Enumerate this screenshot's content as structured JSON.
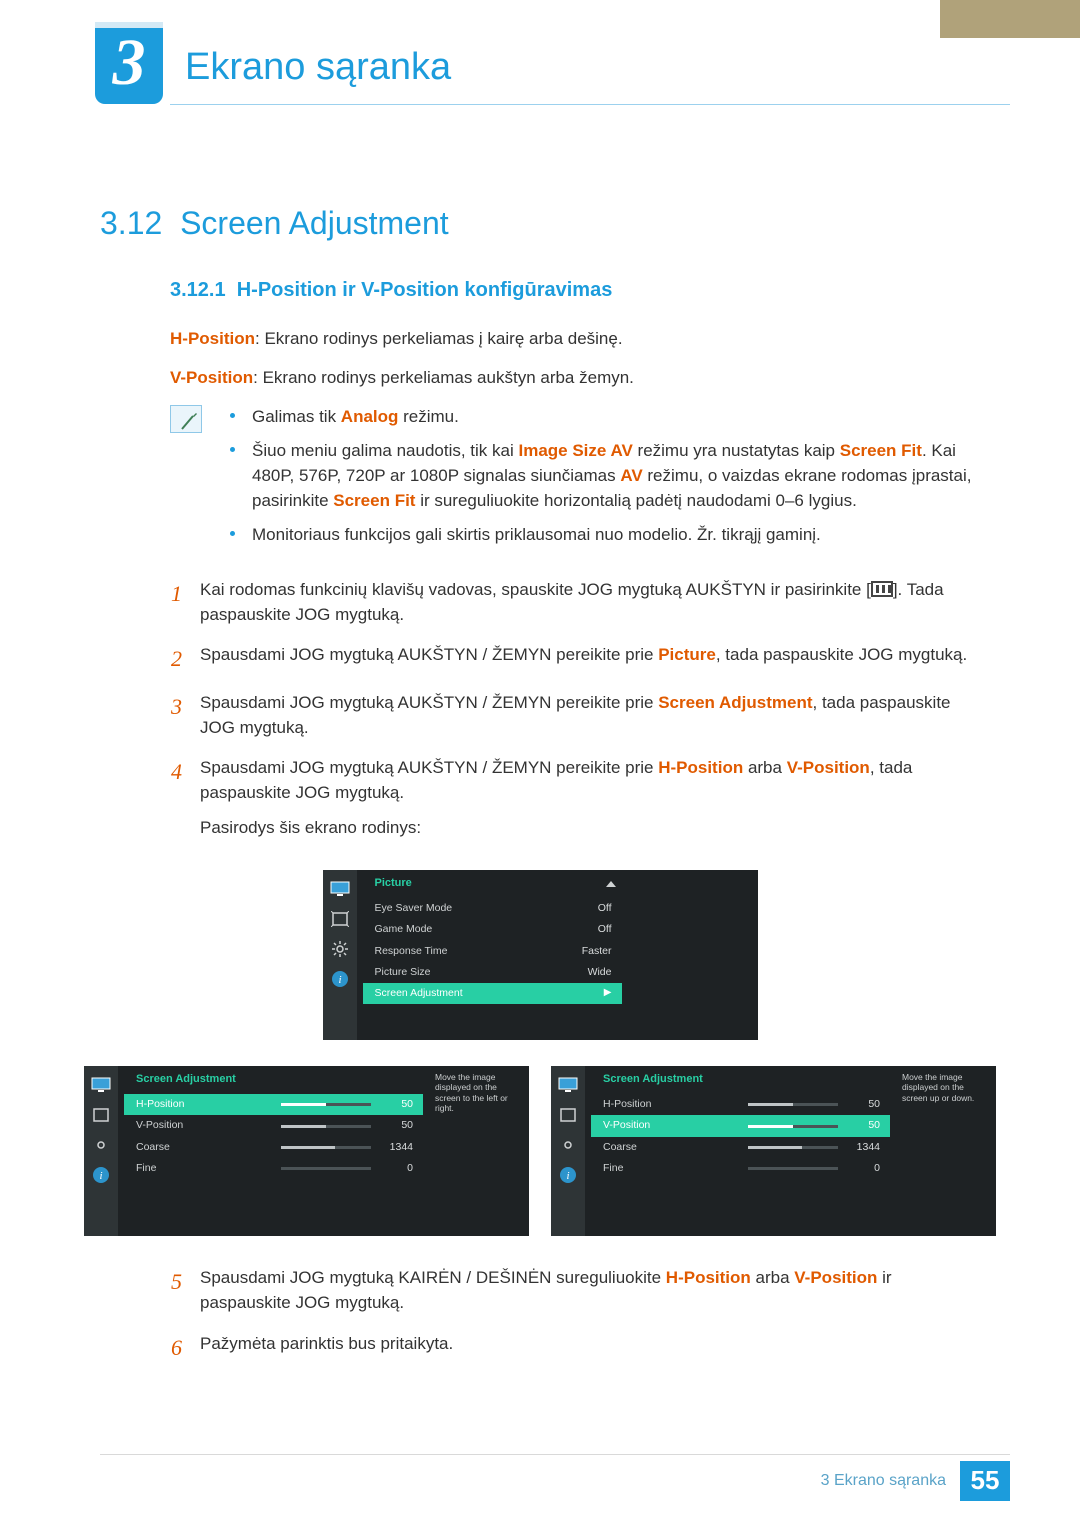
{
  "header": {
    "badge_number": "3",
    "title": "Ekrano sąranka"
  },
  "h2": {
    "num": "3.12",
    "text": "Screen Adjustment"
  },
  "h3": {
    "num": "3.12.1",
    "text": "H-Position ir V-Position konfigūravimas"
  },
  "defs": {
    "hpos_label": "H-Position",
    "hpos_text": ": Ekrano rodinys perkeliamas į kairę arba dešinę.",
    "vpos_label": "V-Position",
    "vpos_text": ": Ekrano rodinys perkeliamas aukštyn arba žemyn."
  },
  "notes": [
    {
      "pre": "Galimas tik ",
      "hl": "Analog",
      "post": " režimu."
    },
    {
      "raw": "Šiuo meniu galima naudotis, tik kai ",
      "hl1": "Image Size AV",
      "mid1": " režimu yra nustatytas kaip ",
      "hl2": "Screen Fit",
      "mid2": ". Kai 480P, 576P, 720P ar 1080P signalas siunčiamas ",
      "hl3": "AV",
      "mid3": " režimu, o vaizdas ekrane rodomas įprastai, pasirinkite ",
      "hl4": "Screen Fit",
      "post": " ir sureguliuokite horizontalią padėtį naudodami 0–6 lygius."
    },
    {
      "plain": "Monitoriaus funkcijos gali skirtis priklausomai nuo modelio. Žr. tikrąjį gaminį."
    }
  ],
  "steps": [
    {
      "n": "1",
      "pre": "Kai rodomas funkcinių klavišų vadovas, spauskite JOG mygtuką AUKŠTYN ir pasirinkite [",
      "post": "]. Tada paspauskite JOG mygtuką."
    },
    {
      "n": "2",
      "pre": "Spausdami JOG mygtuką AUKŠTYN / ŽEMYN pereikite prie ",
      "hl": "Picture",
      "post": ", tada paspauskite JOG mygtuką."
    },
    {
      "n": "3",
      "pre": "Spausdami JOG mygtuką AUKŠTYN / ŽEMYN pereikite prie ",
      "hl": "Screen Adjustment",
      "post": ", tada paspauskite JOG mygtuką."
    },
    {
      "n": "4",
      "pre": "Spausdami JOG mygtuką AUKŠTYN / ŽEMYN pereikite prie ",
      "hl": "H-Position",
      "mid": " arba ",
      "hl2": "V-Position",
      "post": ", tada paspauskite JOG mygtuką.",
      "tail": "Pasirodys šis ekrano rodinys:"
    },
    {
      "n": "5",
      "pre": "Spausdami JOG mygtuką KAIRĖN / DEŠINĖN sureguliuokite ",
      "hl": "H-Position",
      "mid": " arba ",
      "hl2": "V-Position",
      "post": " ir paspauskite JOG mygtuką."
    },
    {
      "n": "6",
      "text": "Pažymėta parinktis bus pritaikyta."
    }
  ],
  "osd1": {
    "title": "Picture",
    "items": [
      {
        "label": "Eye Saver Mode",
        "val": "Off"
      },
      {
        "label": "Game Mode",
        "val": "Off"
      },
      {
        "label": "Response Time",
        "val": "Faster"
      },
      {
        "label": "Picture Size",
        "val": "Wide"
      },
      {
        "label": "Screen Adjustment",
        "selected": true
      }
    ]
  },
  "osd2": {
    "title": "Screen Adjustment",
    "tip": "Move the image displayed on the screen to the left or right.",
    "items": [
      {
        "label": "H-Position",
        "val": "50",
        "pct": 50,
        "selected": true
      },
      {
        "label": "V-Position",
        "val": "50",
        "pct": 50
      },
      {
        "label": "Coarse",
        "val": "1344",
        "pct": 60
      },
      {
        "label": "Fine",
        "val": "0",
        "pct": 0
      }
    ]
  },
  "osd3": {
    "title": "Screen Adjustment",
    "tip": "Move the image displayed on the screen up or down.",
    "items": [
      {
        "label": "H-Position",
        "val": "50",
        "pct": 50
      },
      {
        "label": "V-Position",
        "val": "50",
        "pct": 50,
        "selected": true
      },
      {
        "label": "Coarse",
        "val": "1344",
        "pct": 60
      },
      {
        "label": "Fine",
        "val": "0",
        "pct": 0
      }
    ]
  },
  "footer": {
    "label": "3 Ekrano sąranka",
    "page": "55"
  }
}
